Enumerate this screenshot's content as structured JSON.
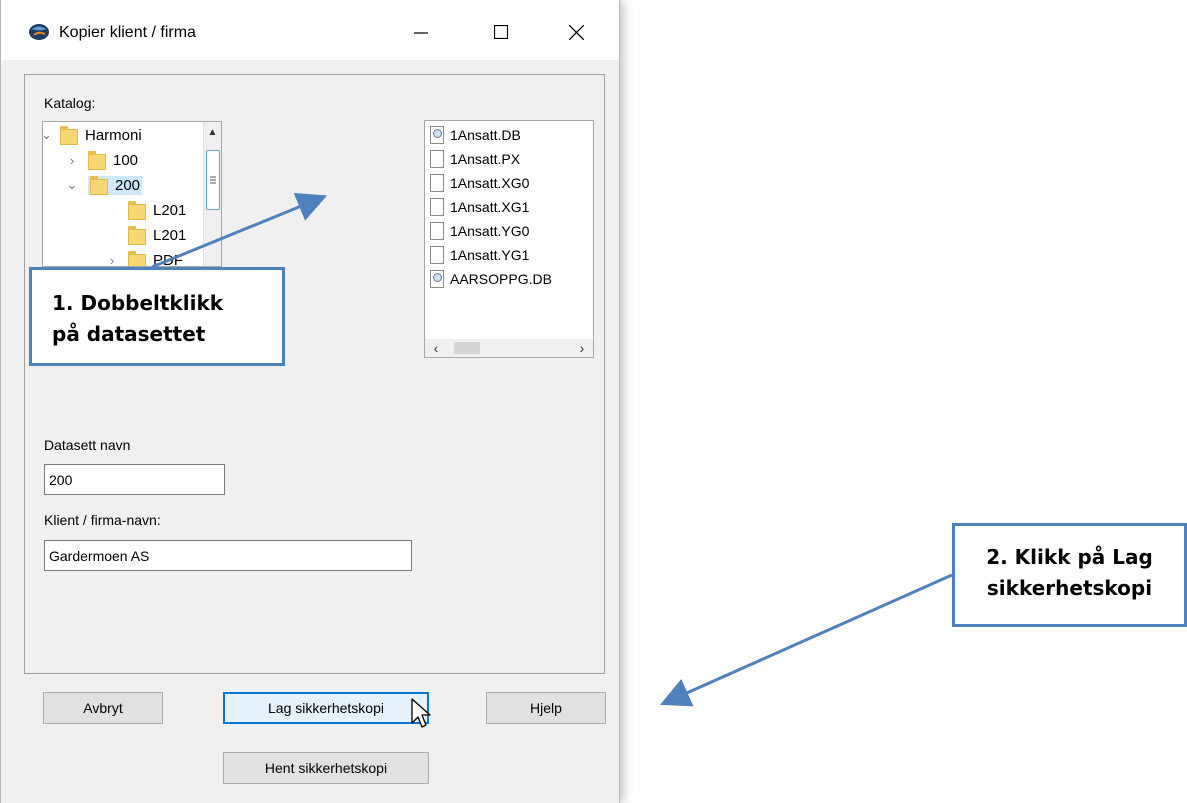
{
  "window": {
    "title": "Kopier klient / firma",
    "controls": [
      "minimize-icon",
      "maximize-icon",
      "close-icon"
    ]
  },
  "catalog": {
    "label": "Katalog:",
    "tree": [
      {
        "label": "Harmoni",
        "expander": "chevron-down-icon"
      },
      {
        "label": "100",
        "expander": "chevron-right-icon"
      },
      {
        "label": "200",
        "expander": "chevron-down-icon",
        "selected": true
      },
      {
        "label": "L201",
        "expander": ""
      },
      {
        "label": "L201",
        "expander": ""
      },
      {
        "label": "PDF",
        "expander": "chevron-right-icon"
      }
    ]
  },
  "files": [
    {
      "name": "1Ansatt.DB",
      "icon": "db-file-icon"
    },
    {
      "name": "1Ansatt.PX",
      "icon": "file-icon"
    },
    {
      "name": "1Ansatt.XG0",
      "icon": "file-icon"
    },
    {
      "name": "1Ansatt.XG1",
      "icon": "file-icon"
    },
    {
      "name": "1Ansatt.YG0",
      "icon": "file-icon"
    },
    {
      "name": "1Ansatt.YG1",
      "icon": "file-icon"
    },
    {
      "name": "AARSOPPG.DB",
      "icon": "db-file-icon"
    }
  ],
  "form": {
    "dataset_label": "Datasett navn",
    "dataset_value": "200",
    "client_label": "Klient / firma-navn:",
    "client_value": "Gardermoen AS"
  },
  "buttons": {
    "cancel": "Avbryt",
    "backup": "Lag sikkerhetskopi",
    "help": "Hjelp",
    "restore": "Hent sikkerhetskopi"
  },
  "callouts": {
    "step1_line1": "1. Dobbeltklikk",
    "step1_line2": "på datasettet",
    "step2_line1": "2. Klikk på Lag",
    "step2_line2": "sikkerhetskopi"
  },
  "colors": {
    "callout_border": "#4f81bd",
    "arrow": "#4f81bd",
    "selection": "#cde8ff",
    "default_button_border": "#0078d7"
  }
}
